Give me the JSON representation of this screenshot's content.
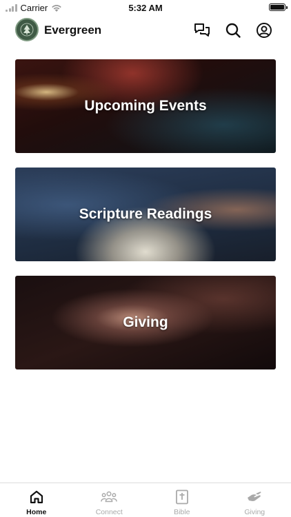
{
  "status_bar": {
    "carrier": "Carrier",
    "time": "5:32 AM",
    "battery_percent": 100
  },
  "header": {
    "app_name": "Evergreen",
    "icons": [
      "chat-icon",
      "search-icon",
      "profile-icon"
    ]
  },
  "cards": [
    {
      "title": "Upcoming Events"
    },
    {
      "title": "Scripture Readings"
    },
    {
      "title": "Giving"
    }
  ],
  "tab_bar": {
    "tabs": [
      {
        "label": "Home",
        "icon": "home-icon",
        "active": true
      },
      {
        "label": "Connect",
        "icon": "people-icon",
        "active": false
      },
      {
        "label": "Bible",
        "icon": "bible-icon",
        "active": false
      },
      {
        "label": "Giving",
        "icon": "giving-hand-icon",
        "active": false
      }
    ]
  },
  "colors": {
    "active_tab": "#111111",
    "inactive_tab": "#a9a9a9",
    "logo_green": "#3f5a45"
  }
}
